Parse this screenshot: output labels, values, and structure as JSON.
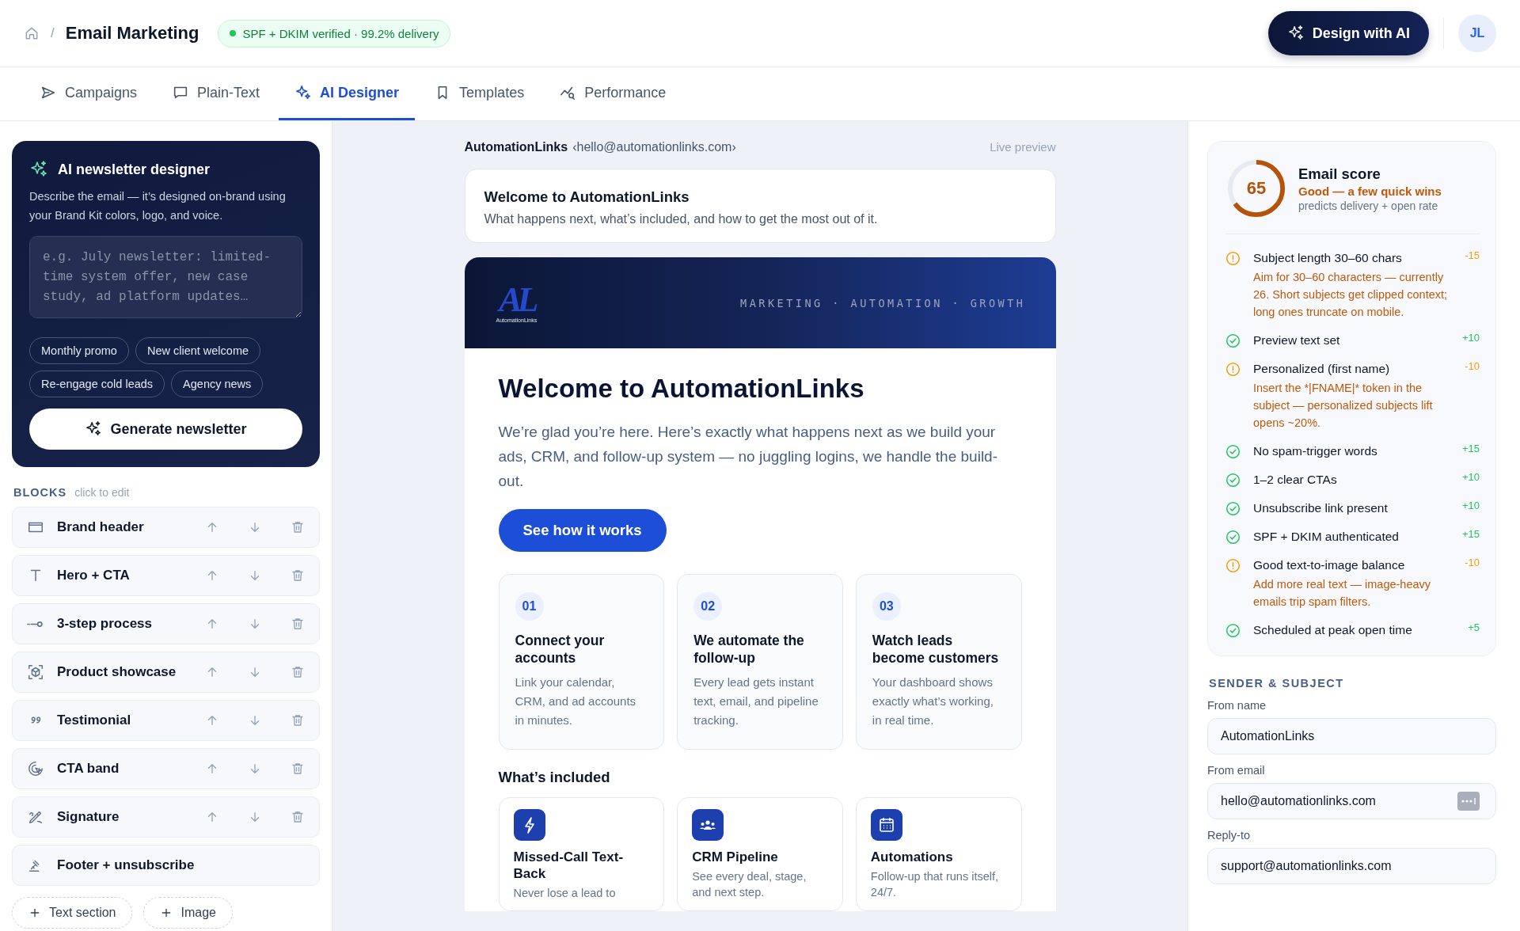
{
  "header": {
    "breadcrumb_separator": "/",
    "title": "Email Marketing",
    "status_badge": "SPF + DKIM verified · 99.2% delivery",
    "primary_button": "Design with AI",
    "avatar": "JL"
  },
  "tabs": [
    {
      "label": "Campaigns",
      "selected": false
    },
    {
      "label": "Plain-Text",
      "selected": false
    },
    {
      "label": "AI Designer",
      "selected": true
    },
    {
      "label": "Templates",
      "selected": false
    },
    {
      "label": "Performance",
      "selected": false
    }
  ],
  "designer": {
    "title": "AI newsletter designer",
    "description": "Describe the email — it’s designed on-brand using your Brand Kit colors, logo, and voice.",
    "prompt_placeholder": "e.g. July newsletter: limited-time system offer, new case study, ad platform updates…",
    "chips": [
      "Monthly promo",
      "New client welcome",
      "Re-engage cold leads",
      "Agency news"
    ],
    "generate_button": "Generate newsletter"
  },
  "blocks": {
    "heading": "BLOCKS",
    "hint": "click to edit",
    "items": [
      {
        "label": "Brand header",
        "reorderable": true
      },
      {
        "label": "Hero + CTA",
        "reorderable": true
      },
      {
        "label": "3-step process",
        "reorderable": true
      },
      {
        "label": "Product showcase",
        "reorderable": true
      },
      {
        "label": "Testimonial",
        "reorderable": true
      },
      {
        "label": "CTA band",
        "reorderable": true
      },
      {
        "label": "Signature",
        "reorderable": true
      },
      {
        "label": "Footer + unsubscribe",
        "reorderable": false
      }
    ],
    "add_buttons": [
      "Text section",
      "Image"
    ]
  },
  "preview": {
    "sender_name": "AutomationLinks",
    "sender_email": "‹hello@automationlinks.com›",
    "mode_label": "Live preview",
    "subject": "Welcome to AutomationLinks",
    "preheader": "What happens next, what’s included, and how to get the most out of it.",
    "brand": {
      "logo_mark": "AL",
      "logo_caption": "AutomationLinks",
      "tagline": "MARKETING · AUTOMATION · GROWTH"
    },
    "headline": "Welcome to AutomationLinks",
    "intro": "We’re glad you’re here. Here’s exactly what happens next as we build your ads, CRM, and follow-up system — no juggling logins, we handle the build-out.",
    "cta": "See how it works",
    "steps": [
      {
        "number": "01",
        "title": "Connect your accounts",
        "text": "Link your calendar, CRM, and ad accounts in minutes."
      },
      {
        "number": "02",
        "title": "We automate the follow-up",
        "text": "Every lead gets instant text, email, and pipeline tracking."
      },
      {
        "number": "03",
        "title": "Watch leads become customers",
        "text": "Your dashboard shows exactly what’s working, in real time."
      }
    ],
    "included_heading": "What’s included",
    "features": [
      {
        "title": "Missed-Call Text-Back",
        "text": "Never lose a lead to"
      },
      {
        "title": "CRM Pipeline",
        "text": "See every deal, stage, and next step."
      },
      {
        "title": "Automations",
        "text": "Follow-up that runs itself, 24/7."
      }
    ]
  },
  "score": {
    "value": "65",
    "level": 0.65,
    "title": "Email score",
    "verdict": "Good — a few quick wins",
    "subtitle": "predicts delivery + open rate",
    "checks": [
      {
        "kind": "warn",
        "label": "Subject length 30–60 chars",
        "points": "-15",
        "detail": "Aim for 30–60 characters — currently 26. Short subjects get clipped context; long ones truncate on mobile."
      },
      {
        "kind": "pass",
        "label": "Preview text set",
        "points": "+10"
      },
      {
        "kind": "warn",
        "label": "Personalized (first name)",
        "points": "-10",
        "detail": "Insert the *|FNAME|* token in the subject — personalized subjects lift opens ~20%."
      },
      {
        "kind": "pass",
        "label": "No spam-trigger words",
        "points": "+15"
      },
      {
        "kind": "pass",
        "label": "1–2 clear CTAs",
        "points": "+10"
      },
      {
        "kind": "pass",
        "label": "Unsubscribe link present",
        "points": "+10"
      },
      {
        "kind": "pass",
        "label": "SPF + DKIM authenticated",
        "points": "+15"
      },
      {
        "kind": "warn",
        "label": "Good text-to-image balance",
        "points": "-10",
        "detail": "Add more real text — image-heavy emails trip spam filters."
      },
      {
        "kind": "pass",
        "label": "Scheduled at peak open time",
        "points": "+5"
      }
    ]
  },
  "sender": {
    "heading": "SENDER & SUBJECT",
    "fields": [
      {
        "label": "From name",
        "value": "AutomationLinks"
      },
      {
        "label": "From email",
        "value": "hello@automationlinks.com"
      },
      {
        "label": "Reply-to",
        "value": "support@automationlinks.com"
      }
    ]
  }
}
